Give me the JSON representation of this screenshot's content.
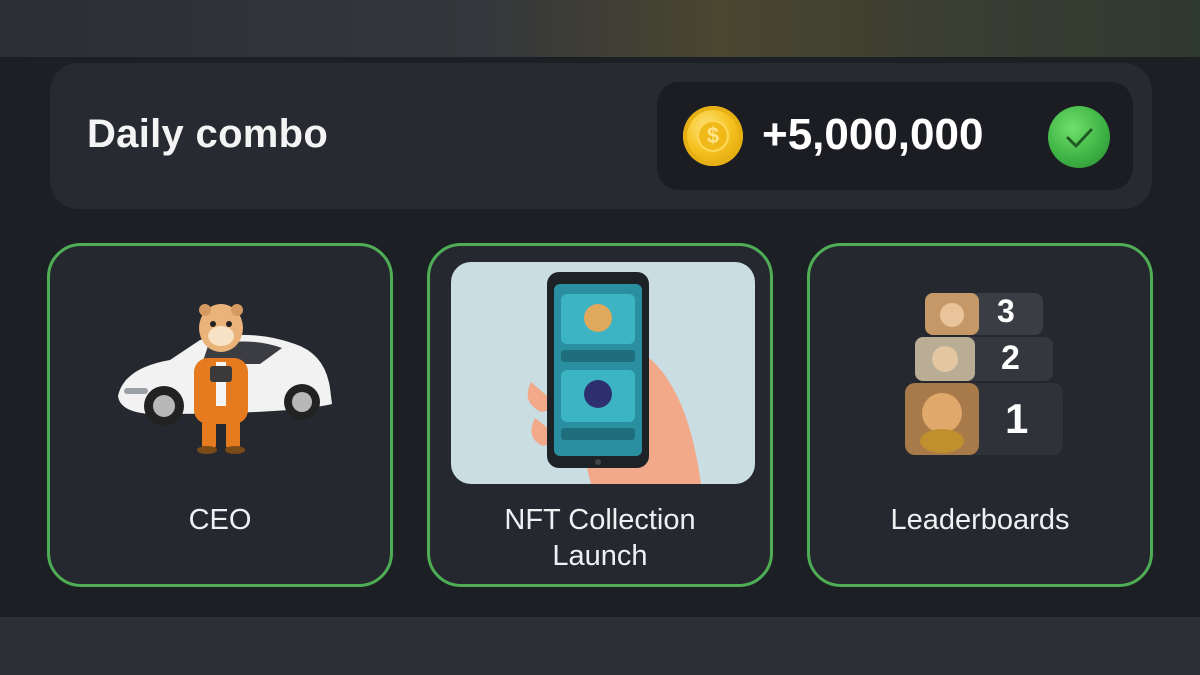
{
  "header": {
    "title": "Daily combo",
    "reward_amount": "+5,000,000",
    "coin_icon": "coin-icon",
    "check_icon": "check-icon",
    "check_color": "#3cb043"
  },
  "cards": [
    {
      "label": "CEO",
      "image": "hamster-ceo-with-car-image"
    },
    {
      "label_line1": "NFT Collection",
      "label_line2": "Launch",
      "image": "phone-nft-collection-image"
    },
    {
      "label": "Leaderboards",
      "image": "leaderboard-ranking-image",
      "ranks": [
        "3",
        "2",
        "1"
      ]
    }
  ],
  "colors": {
    "card_border": "#4fae55",
    "background": "#1c1f24",
    "panel": "#272a30"
  }
}
